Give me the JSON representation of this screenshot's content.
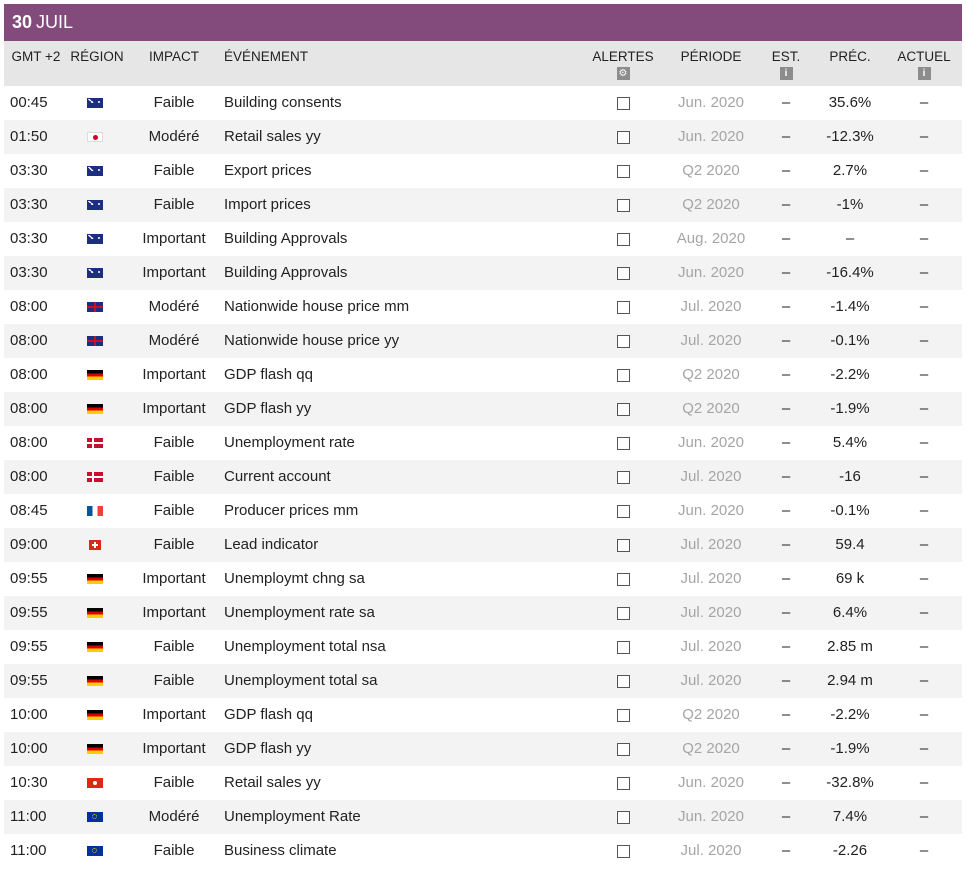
{
  "banner": {
    "day": "30",
    "month": "JUIL"
  },
  "headers": {
    "time": "GMT +2",
    "region": "RÉGION",
    "impact": "IMPACT",
    "event": "ÉVÉNEMENT",
    "alerts": "ALERTES",
    "period": "PÉRIODE",
    "est": "EST.",
    "prec": "PRÉC.",
    "actual": "ACTUEL"
  },
  "colors": {
    "banner": "#834a7c",
    "header_bg": "#e6e6e6",
    "period_text": "#a5a5a5"
  },
  "rows": [
    {
      "time": "00:45",
      "region": "au",
      "impact": "Faible",
      "event": "Building consents",
      "alert": false,
      "period": "Jun. 2020",
      "est": "–",
      "prec": "35.6%",
      "actual": "–"
    },
    {
      "time": "01:50",
      "region": "jp",
      "impact": "Modéré",
      "event": "Retail sales yy",
      "alert": false,
      "period": "Jun. 2020",
      "est": "–",
      "prec": "-12.3%",
      "actual": "–"
    },
    {
      "time": "03:30",
      "region": "au",
      "impact": "Faible",
      "event": "Export prices",
      "alert": false,
      "period": "Q2 2020",
      "est": "–",
      "prec": "2.7%",
      "actual": "–"
    },
    {
      "time": "03:30",
      "region": "au",
      "impact": "Faible",
      "event": "Import prices",
      "alert": false,
      "period": "Q2 2020",
      "est": "–",
      "prec": "-1%",
      "actual": "–"
    },
    {
      "time": "03:30",
      "region": "au",
      "impact": "Important",
      "event": "Building Approvals",
      "alert": false,
      "period": "Aug. 2020",
      "est": "–",
      "prec": "–",
      "actual": "–"
    },
    {
      "time": "03:30",
      "region": "au",
      "impact": "Important",
      "event": "Building Approvals",
      "alert": false,
      "period": "Jun. 2020",
      "est": "–",
      "prec": "-16.4%",
      "actual": "–"
    },
    {
      "time": "08:00",
      "region": "gb",
      "impact": "Modéré",
      "event": "Nationwide house price mm",
      "alert": false,
      "period": "Jul. 2020",
      "est": "–",
      "prec": "-1.4%",
      "actual": "–"
    },
    {
      "time": "08:00",
      "region": "gb",
      "impact": "Modéré",
      "event": "Nationwide house price yy",
      "alert": false,
      "period": "Jul. 2020",
      "est": "–",
      "prec": "-0.1%",
      "actual": "–"
    },
    {
      "time": "08:00",
      "region": "de",
      "impact": "Important",
      "event": "GDP flash qq",
      "alert": false,
      "period": "Q2 2020",
      "est": "–",
      "prec": "-2.2%",
      "actual": "–"
    },
    {
      "time": "08:00",
      "region": "de",
      "impact": "Important",
      "event": "GDP flash yy",
      "alert": false,
      "period": "Q2 2020",
      "est": "–",
      "prec": "-1.9%",
      "actual": "–"
    },
    {
      "time": "08:00",
      "region": "dk",
      "impact": "Faible",
      "event": "Unemployment rate",
      "alert": false,
      "period": "Jun. 2020",
      "est": "–",
      "prec": "5.4%",
      "actual": "–"
    },
    {
      "time": "08:00",
      "region": "dk",
      "impact": "Faible",
      "event": "Current account",
      "alert": false,
      "period": "Jul. 2020",
      "est": "–",
      "prec": "-16",
      "actual": "–"
    },
    {
      "time": "08:45",
      "region": "fr",
      "impact": "Faible",
      "event": "Producer prices mm",
      "alert": false,
      "period": "Jun. 2020",
      "est": "–",
      "prec": "-0.1%",
      "actual": "–"
    },
    {
      "time": "09:00",
      "region": "ch",
      "impact": "Faible",
      "event": "Lead indicator",
      "alert": false,
      "period": "Jul. 2020",
      "est": "–",
      "prec": "59.4",
      "actual": "–"
    },
    {
      "time": "09:55",
      "region": "de",
      "impact": "Important",
      "event": "Unemploymt chng sa",
      "alert": false,
      "period": "Jul. 2020",
      "est": "–",
      "prec": "69 k",
      "actual": "–"
    },
    {
      "time": "09:55",
      "region": "de",
      "impact": "Important",
      "event": "Unemployment rate sa",
      "alert": false,
      "period": "Jul. 2020",
      "est": "–",
      "prec": "6.4%",
      "actual": "–"
    },
    {
      "time": "09:55",
      "region": "de",
      "impact": "Faible",
      "event": "Unemployment total nsa",
      "alert": false,
      "period": "Jul. 2020",
      "est": "–",
      "prec": "2.85 m",
      "actual": "–"
    },
    {
      "time": "09:55",
      "region": "de",
      "impact": "Faible",
      "event": "Unemployment total sa",
      "alert": false,
      "period": "Jul. 2020",
      "est": "–",
      "prec": "2.94 m",
      "actual": "–"
    },
    {
      "time": "10:00",
      "region": "de",
      "impact": "Important",
      "event": "GDP flash qq",
      "alert": false,
      "period": "Q2 2020",
      "est": "–",
      "prec": "-2.2%",
      "actual": "–"
    },
    {
      "time": "10:00",
      "region": "de",
      "impact": "Important",
      "event": "GDP flash yy",
      "alert": false,
      "period": "Q2 2020",
      "est": "–",
      "prec": "-1.9%",
      "actual": "–"
    },
    {
      "time": "10:30",
      "region": "hk",
      "impact": "Faible",
      "event": "Retail sales yy",
      "alert": false,
      "period": "Jun. 2020",
      "est": "–",
      "prec": "-32.8%",
      "actual": "–"
    },
    {
      "time": "11:00",
      "region": "eu",
      "impact": "Modéré",
      "event": "Unemployment Rate",
      "alert": false,
      "period": "Jun. 2020",
      "est": "–",
      "prec": "7.4%",
      "actual": "–"
    },
    {
      "time": "11:00",
      "region": "eu",
      "impact": "Faible",
      "event": "Business climate",
      "alert": false,
      "period": "Jul. 2020",
      "est": "–",
      "prec": "-2.26",
      "actual": "–"
    }
  ]
}
